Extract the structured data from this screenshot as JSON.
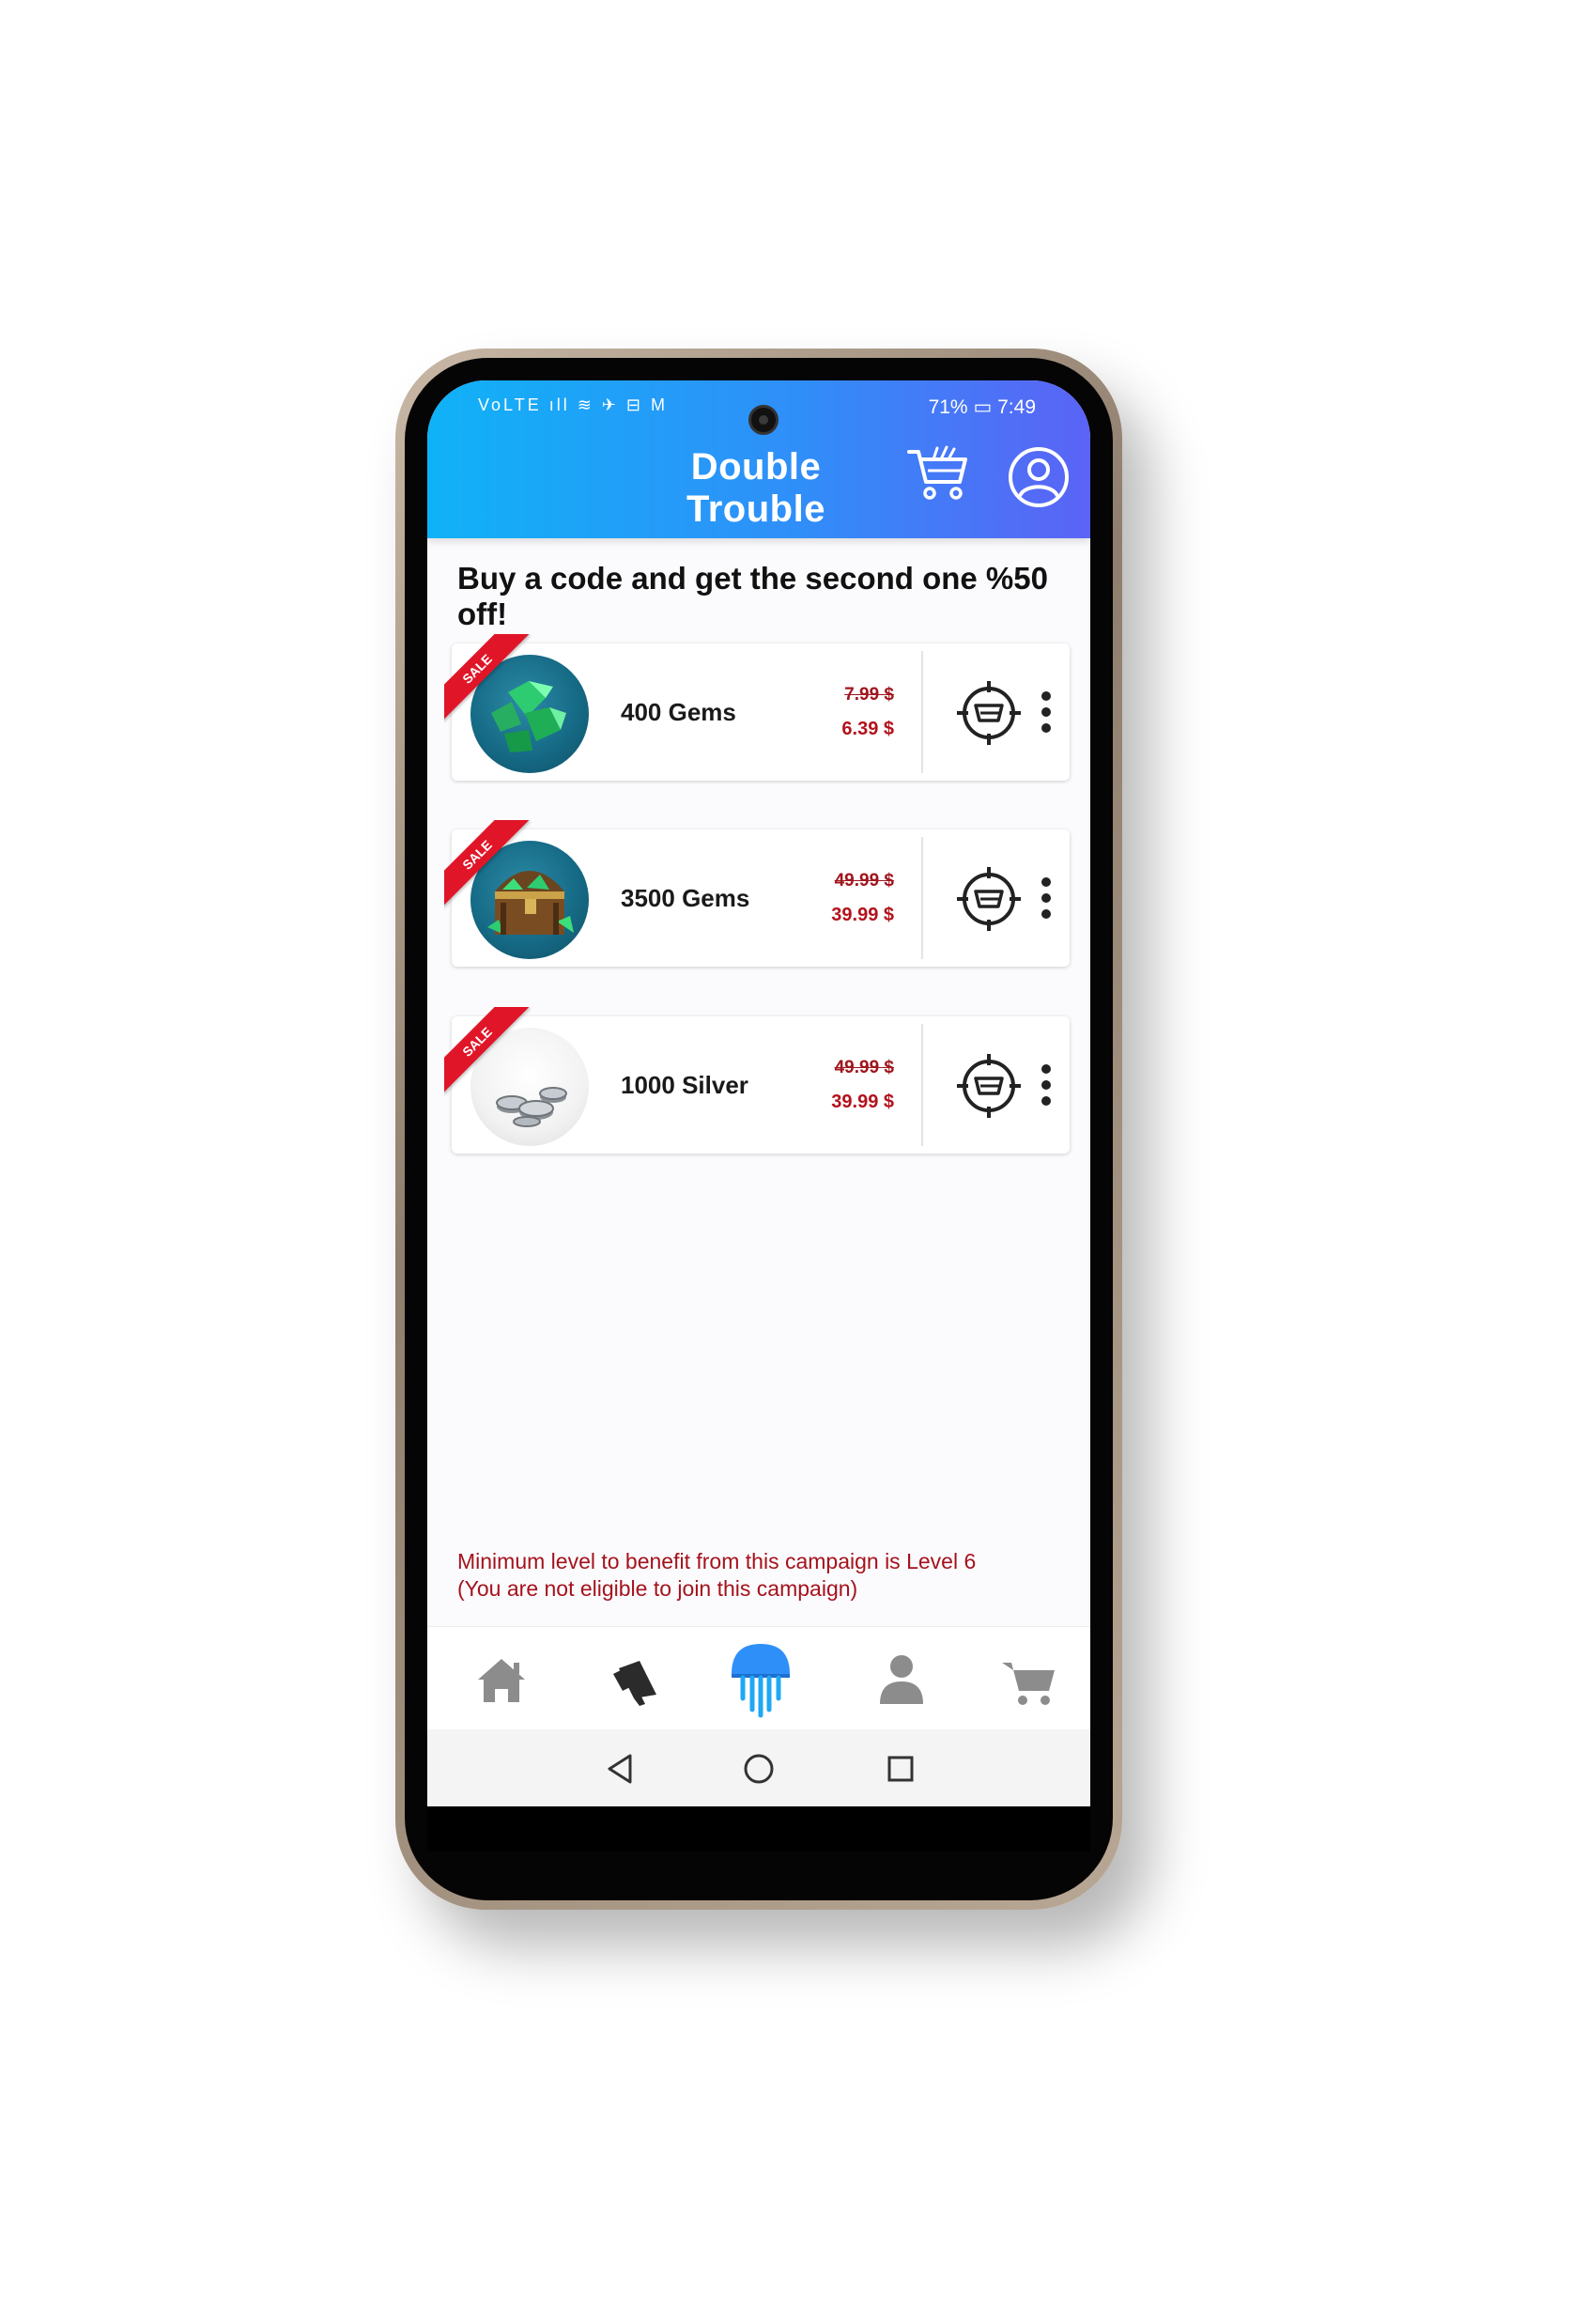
{
  "status_bar": {
    "left_icons": "VoLTE ıll ≋ ✈ ⊟ M",
    "battery_percent": "71%",
    "time": "7:49"
  },
  "header": {
    "title": "Double Trouble"
  },
  "headline": "Buy a code and get the second one %50 off!",
  "products": [
    {
      "name": "400 Gems",
      "old_price": "7.99 $",
      "new_price": "6.39 $",
      "badge": "SALE",
      "image": "green-gems"
    },
    {
      "name": "3500 Gems",
      "old_price": "49.99 $",
      "new_price": "39.99 $",
      "badge": "SALE",
      "image": "treasure-chest"
    },
    {
      "name": "1000 Silver",
      "old_price": "49.99 $",
      "new_price": "39.99 $",
      "badge": "SALE",
      "image": "silver-coins"
    }
  ],
  "notice": {
    "line1": "Minimum level to benefit from this campaign is Level 6",
    "line2": "(You are not eligible to join this campaign)"
  },
  "bottom_nav": [
    {
      "icon": "home-icon"
    },
    {
      "icon": "megaphone-icon"
    },
    {
      "icon": "jellyfish-icon",
      "active": true
    },
    {
      "icon": "person-icon"
    },
    {
      "icon": "cart-icon"
    }
  ],
  "colors": {
    "header_gradient_start": "#10b2f7",
    "header_gradient_end": "#5b63f6",
    "price_red": "#b3121c",
    "sale_red": "#e01628",
    "active_nav_blue": "#2f8ff8"
  }
}
